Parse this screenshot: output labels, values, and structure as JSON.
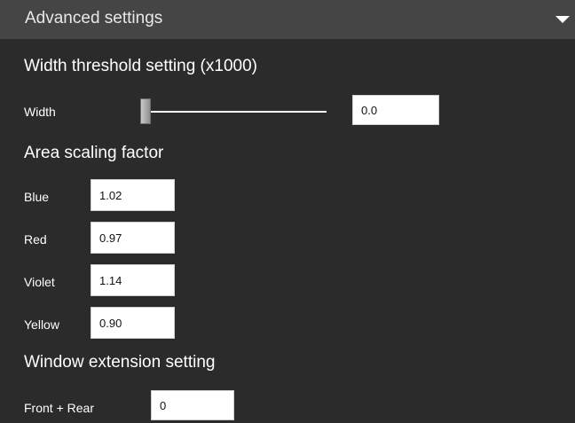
{
  "header": {
    "title": "Advanced settings",
    "collapse_icon": "chevron-down-icon"
  },
  "width_threshold": {
    "title": "Width threshold setting (x1000)",
    "label": "Width",
    "slider_value": 0.0,
    "value": "0.0"
  },
  "area_scaling": {
    "title": "Area scaling factor",
    "rows": [
      {
        "label": "Blue",
        "value": "1.02"
      },
      {
        "label": "Red",
        "value": "0.97"
      },
      {
        "label": "Violet",
        "value": "1.14"
      },
      {
        "label": "Yellow",
        "value": "0.90"
      }
    ]
  },
  "window_extension": {
    "title": "Window extension setting",
    "label": "Front + Rear",
    "value": "0"
  },
  "colors": {
    "background": "#2b2b2b",
    "header_background": "#454545"
  }
}
